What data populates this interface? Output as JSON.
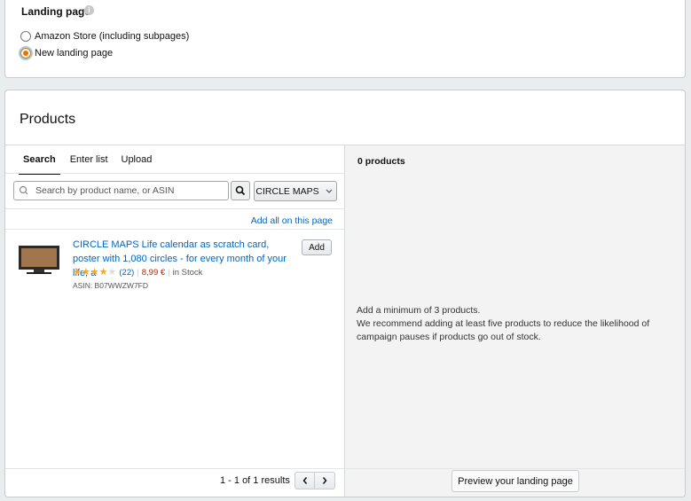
{
  "landing": {
    "label": "Landing page",
    "info_icon": "i",
    "options": [
      {
        "label": "Amazon Store (including subpages)",
        "checked": false
      },
      {
        "label": "New landing page",
        "checked": true
      }
    ]
  },
  "products": {
    "title": "Products",
    "tabs": [
      {
        "label": "Search",
        "active": true
      },
      {
        "label": "Enter list",
        "active": false
      },
      {
        "label": "Upload",
        "active": false
      }
    ],
    "search": {
      "placeholder": "Search by product name, or ASIN",
      "value": ""
    },
    "brand_filter": "CIRCLE MAPS",
    "add_all": "Add all on this page",
    "items": [
      {
        "title": "CIRCLE MAPS Life calendar as scratch card, poster with 1,080 circles - for every month of your life, a",
        "rating": 4,
        "reviews": "(22)",
        "price": "8,99 €",
        "stock": "in Stock",
        "asin": "ASIN: B07WWZW7FD",
        "add_label": "Add"
      }
    ],
    "results": "1 - 1 of 1 results",
    "selected_count": "0 products",
    "hint_lines": [
      "Add a minimum of 3 products.",
      "We recommend adding at least five products to reduce the likelihood of campaign pauses if products go out of stock."
    ],
    "preview_label": "Preview your landing page"
  },
  "colors": {
    "accent": "#e77600",
    "link": "#0066c0",
    "price": "#b12704",
    "star": "#ffa41c"
  }
}
